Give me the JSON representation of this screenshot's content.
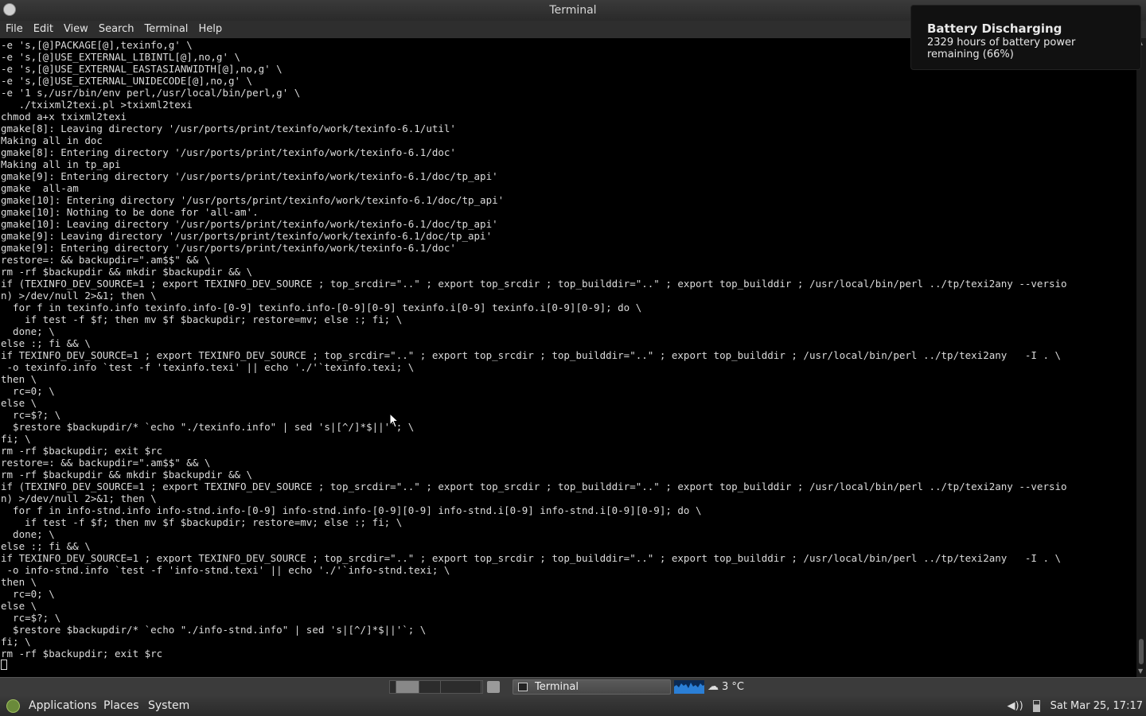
{
  "window": {
    "title": "Terminal"
  },
  "menubar": {
    "items": [
      "File",
      "Edit",
      "View",
      "Search",
      "Terminal",
      "Help"
    ]
  },
  "terminal": {
    "lines": [
      "-e 's,[@]PACKAGE[@],texinfo,g' \\",
      "-e 's,[@]USE_EXTERNAL_LIBINTL[@],no,g' \\",
      "-e 's,[@]USE_EXTERNAL_EASTASIANWIDTH[@],no,g' \\",
      "-e 's,[@]USE_EXTERNAL_UNIDECODE[@],no,g' \\",
      "-e '1 s,/usr/bin/env perl,/usr/local/bin/perl,g' \\",
      "   ./txixml2texi.pl >txixml2texi",
      "chmod a+x txixml2texi",
      "gmake[8]: Leaving directory '/usr/ports/print/texinfo/work/texinfo-6.1/util'",
      "Making all in doc",
      "gmake[8]: Entering directory '/usr/ports/print/texinfo/work/texinfo-6.1/doc'",
      "Making all in tp_api",
      "gmake[9]: Entering directory '/usr/ports/print/texinfo/work/texinfo-6.1/doc/tp_api'",
      "gmake  all-am",
      "gmake[10]: Entering directory '/usr/ports/print/texinfo/work/texinfo-6.1/doc/tp_api'",
      "gmake[10]: Nothing to be done for 'all-am'.",
      "gmake[10]: Leaving directory '/usr/ports/print/texinfo/work/texinfo-6.1/doc/tp_api'",
      "gmake[9]: Leaving directory '/usr/ports/print/texinfo/work/texinfo-6.1/doc/tp_api'",
      "gmake[9]: Entering directory '/usr/ports/print/texinfo/work/texinfo-6.1/doc'",
      "restore=: && backupdir=\".am$$\" && \\",
      "rm -rf $backupdir && mkdir $backupdir && \\",
      "if (TEXINFO_DEV_SOURCE=1 ; export TEXINFO_DEV_SOURCE ; top_srcdir=\"..\" ; export top_srcdir ; top_builddir=\"..\" ; export top_builddir ; /usr/local/bin/perl ../tp/texi2any --versio",
      "n) >/dev/null 2>&1; then \\",
      "  for f in texinfo.info texinfo.info-[0-9] texinfo.info-[0-9][0-9] texinfo.i[0-9] texinfo.i[0-9][0-9]; do \\",
      "    if test -f $f; then mv $f $backupdir; restore=mv; else :; fi; \\",
      "  done; \\",
      "else :; fi && \\",
      "if TEXINFO_DEV_SOURCE=1 ; export TEXINFO_DEV_SOURCE ; top_srcdir=\"..\" ; export top_srcdir ; top_builddir=\"..\" ; export top_builddir ; /usr/local/bin/perl ../tp/texi2any   -I . \\",
      " -o texinfo.info `test -f 'texinfo.texi' || echo './'`texinfo.texi; \\",
      "then \\",
      "  rc=0; \\",
      "else \\",
      "  rc=$?; \\",
      "  $restore $backupdir/* `echo \"./texinfo.info\" | sed 's|[^/]*$||'`; \\",
      "fi; \\",
      "rm -rf $backupdir; exit $rc",
      "restore=: && backupdir=\".am$$\" && \\",
      "rm -rf $backupdir && mkdir $backupdir && \\",
      "if (TEXINFO_DEV_SOURCE=1 ; export TEXINFO_DEV_SOURCE ; top_srcdir=\"..\" ; export top_srcdir ; top_builddir=\"..\" ; export top_builddir ; /usr/local/bin/perl ../tp/texi2any --versio",
      "n) >/dev/null 2>&1; then \\",
      "  for f in info-stnd.info info-stnd.info-[0-9] info-stnd.info-[0-9][0-9] info-stnd.i[0-9] info-stnd.i[0-9][0-9]; do \\",
      "    if test -f $f; then mv $f $backupdir; restore=mv; else :; fi; \\",
      "  done; \\",
      "else :; fi && \\",
      "if TEXINFO_DEV_SOURCE=1 ; export TEXINFO_DEV_SOURCE ; top_srcdir=\"..\" ; export top_srcdir ; top_builddir=\"..\" ; export top_builddir ; /usr/local/bin/perl ../tp/texi2any   -I . \\",
      " -o info-stnd.info `test -f 'info-stnd.texi' || echo './'`info-stnd.texi; \\",
      "then \\",
      "  rc=0; \\",
      "else \\",
      "  rc=$?; \\",
      "  $restore $backupdir/* `echo \"./info-stnd.info\" | sed 's|[^/]*$||'`; \\",
      "fi; \\",
      "rm -rf $backupdir; exit $rc"
    ]
  },
  "notification": {
    "title": "Battery Discharging",
    "body_line1": "2329 hours of battery power",
    "body_line2": "remaining (66%)"
  },
  "taskbar": {
    "task_label": "Terminal",
    "weather": "3 °C"
  },
  "panel": {
    "menus": [
      "Applications",
      "Places",
      "System"
    ],
    "clock": "Sat Mar 25, 17:17",
    "battery_level": 0.66
  },
  "icons": {
    "app_icon": "terminal-app-icon",
    "weather": "cloud-icon",
    "volume": "volume-icon",
    "battery": "battery-icon"
  }
}
